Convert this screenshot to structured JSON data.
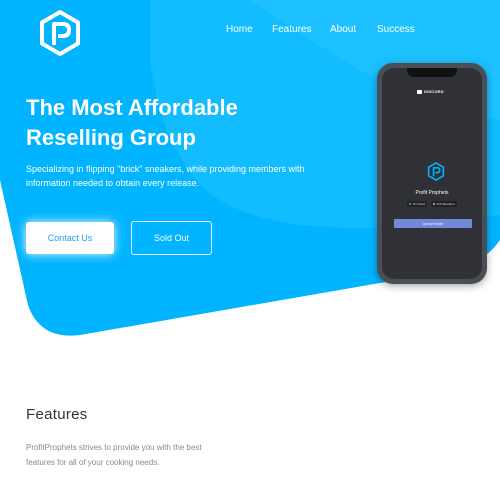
{
  "nav": {
    "items": [
      {
        "label": "Home"
      },
      {
        "label": "Features"
      },
      {
        "label": "About"
      },
      {
        "label": "Success"
      }
    ]
  },
  "hero": {
    "headline_line1": "The Most Affordable",
    "headline_line2": "Reselling Group",
    "subtext": "Specializing in flipping \"brick\" sneakers, while providing members with information needed to obtain every release.",
    "contact_label": "Contact Us",
    "sold_out_label": "Sold Out"
  },
  "phone": {
    "app_label": "DISCORD",
    "server_name": "Profit Prophets",
    "online_label": "75 Online",
    "members_label": "175 Members",
    "accept_label": "Accept Invite"
  },
  "features": {
    "title": "Features",
    "description": "ProfitProphets strives to provide you with the best features for all of your cooking needs."
  },
  "colors": {
    "accent": "#00b4ff",
    "accent_light": "#2fc6ff",
    "discord_blurple": "#7289da",
    "online_green": "#43b581"
  }
}
